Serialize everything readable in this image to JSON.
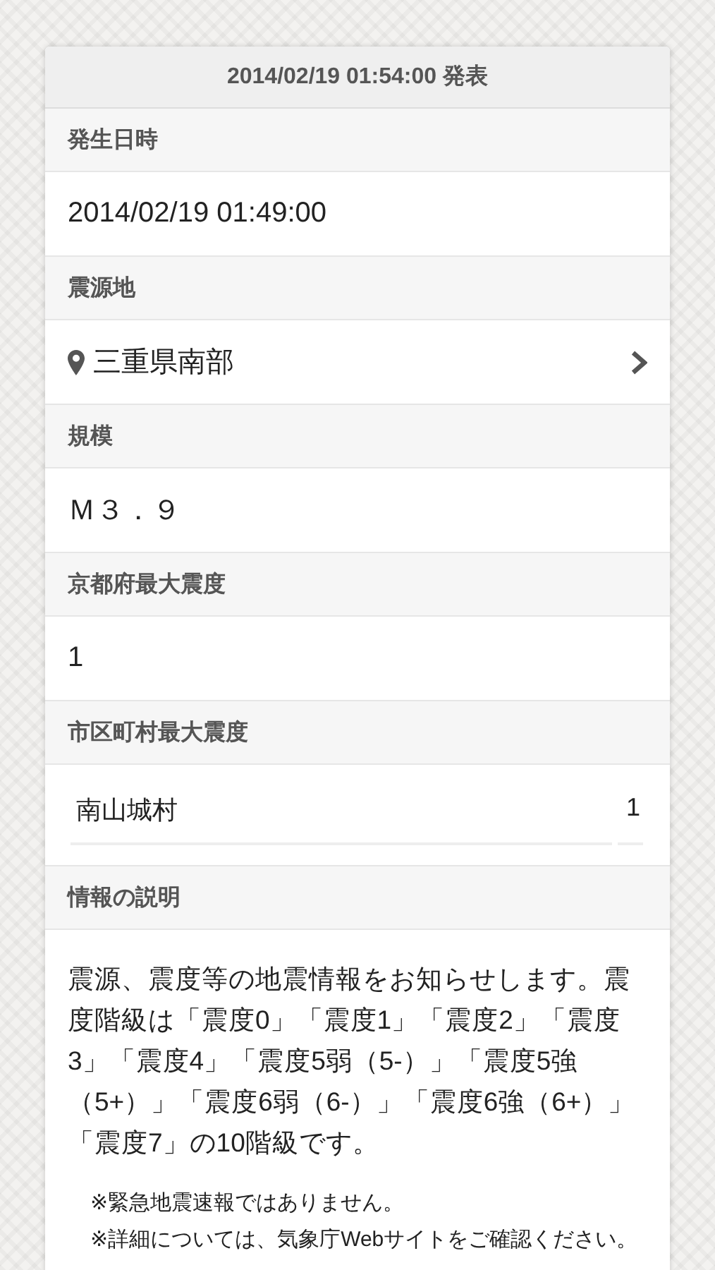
{
  "header": {
    "title": "2014/02/19 01:54:00 発表"
  },
  "sections": [
    {
      "label": "発生日時",
      "kind": "text",
      "value": "2014/02/19 01:49:00"
    },
    {
      "label": "震源地",
      "kind": "location",
      "value": "三重県南部"
    },
    {
      "label": "規模",
      "kind": "text",
      "value": "Ｍ３．９"
    },
    {
      "label": "京都府最大震度",
      "kind": "text",
      "value": "1"
    },
    {
      "label": "市区町村最大震度",
      "kind": "table",
      "rows": [
        {
          "name": "南山城村",
          "intensity": "1"
        }
      ]
    },
    {
      "label": "情報の説明",
      "kind": "paragraph",
      "value": "震源、震度等の地震情報をお知らせします。震度階級は「震度0」「震度1」「震度2」「震度3」「震度4」「震度5弱（5-）」「震度5強（5+）」「震度6弱（6-）」「震度6強（6+）」「震度7」の10階級です。",
      "notes": [
        "※緊急地震速報ではありません。",
        "※詳細については、気象庁Webサイトをご確認ください。"
      ]
    }
  ]
}
